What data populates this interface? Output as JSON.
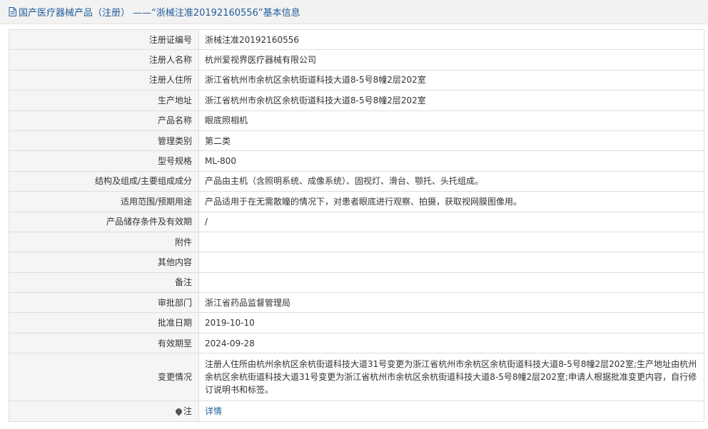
{
  "header": {
    "title": "国产医疗器械产品（注册） ——“浙械注准20192160556”基本信息",
    "icon": "document-icon",
    "color": "#1f5c99"
  },
  "rows": [
    {
      "label": "注册证编号",
      "value": "浙械注准20192160556"
    },
    {
      "label": "注册人名称",
      "value": "杭州爱视界医疗器械有限公司"
    },
    {
      "label": "注册人住所",
      "value": "浙江省杭州市余杭区余杭街道科技大道8-5号8幢2层202室"
    },
    {
      "label": "生产地址",
      "value": "浙江省杭州市余杭区余杭街道科技大道8-5号8幢2层202室"
    },
    {
      "label": "产品名称",
      "value": "眼底照相机"
    },
    {
      "label": "管理类别",
      "value": "第二类"
    },
    {
      "label": "型号规格",
      "value": "ML-800"
    },
    {
      "label": "结构及组成/主要组成成分",
      "value": "产品由主机（含照明系统、成像系统）、固视灯、滑台、颚托、头托组成。"
    },
    {
      "label": "适用范围/预期用途",
      "value": "产品适用于在无需散瞳的情况下，对患者眼底进行观察、拍摄，获取视网膜图像用。"
    },
    {
      "label": "产品储存条件及有效期",
      "value": "/"
    },
    {
      "label": "附件",
      "value": ""
    },
    {
      "label": "其他内容",
      "value": ""
    },
    {
      "label": "备注",
      "value": ""
    },
    {
      "label": "审批部门",
      "value": "浙江省药品监督管理局"
    },
    {
      "label": "批准日期",
      "value": "2019-10-10"
    },
    {
      "label": "有效期至",
      "value": "2024-09-28"
    },
    {
      "label": "变更情况",
      "value": "注册人住所由杭州余杭区余杭街道科技大道31号变更为浙江省杭州市余杭区余杭街道科技大道8-5号8幢2层202室;生产地址由杭州余杭区余杭街道科技大道31号变更为浙江省杭州市余杭区余杭街道科技大道8-5号8幢2层202室;申请人根据批准变更内容，自行修订说明书和标签。"
    }
  ],
  "note": {
    "label": "注",
    "icon": "lightbulb-icon",
    "link_text": "详情",
    "link_color": "#1f5c99"
  }
}
